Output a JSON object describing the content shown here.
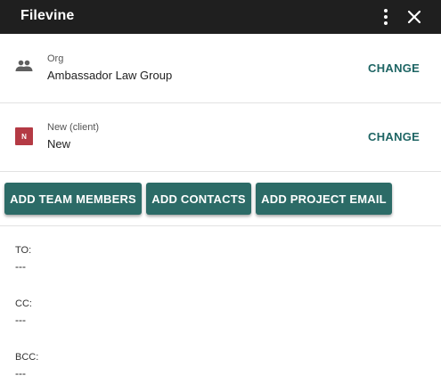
{
  "header": {
    "title": "Filevine",
    "menu_icon": "more-vertical-icon",
    "close_icon": "close-icon",
    "background": "#1f1f1f"
  },
  "org": {
    "label": "Org",
    "value": "Ambassador Law Group",
    "icon": "people-icon",
    "change_label": "CHANGE"
  },
  "project": {
    "label": "New (client)",
    "value": "New",
    "badge_letter": "N",
    "badge_color": "#b43a44",
    "change_label": "CHANGE"
  },
  "actions": {
    "add_team_members": "ADD TEAM MEMBERS",
    "add_contacts": "ADD CONTACTS",
    "add_project_email": "ADD PROJECT EMAIL",
    "button_color": "#2c6b67"
  },
  "recipients": {
    "to": {
      "label": "TO:",
      "value": "---"
    },
    "cc": {
      "label": "CC:",
      "value": "---"
    },
    "bcc": {
      "label": "BCC:",
      "value": "---"
    }
  },
  "accent_color": "#1e6564"
}
